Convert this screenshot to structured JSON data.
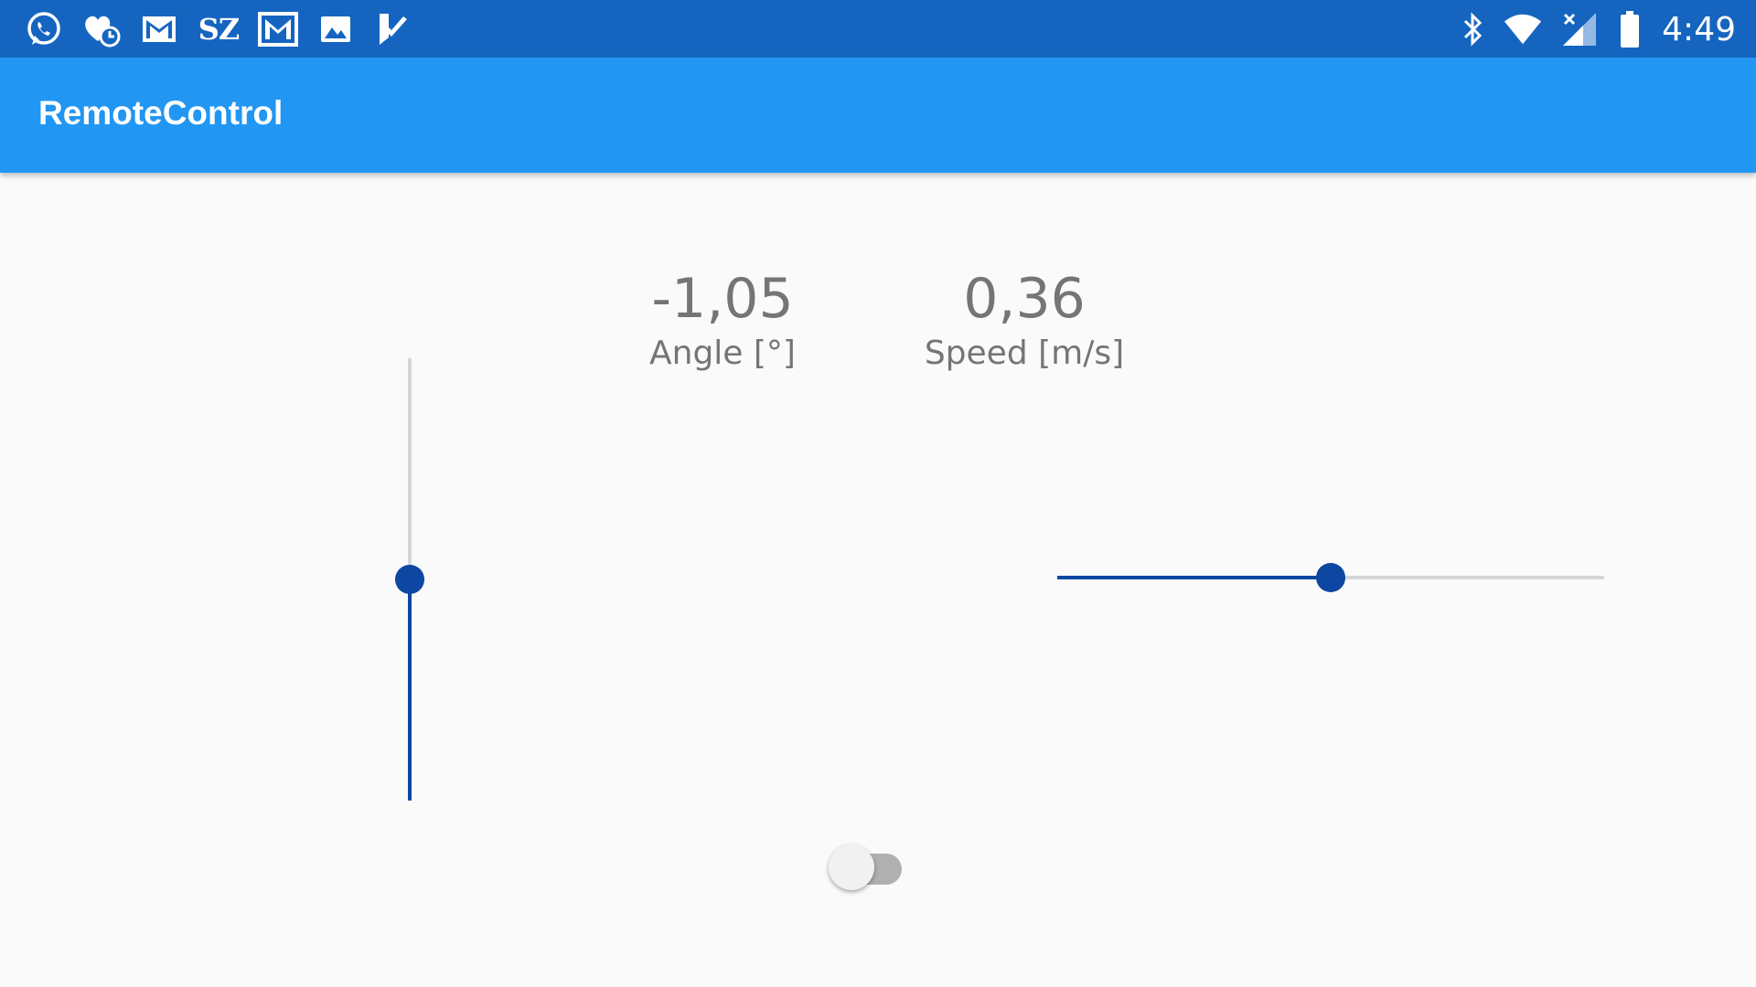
{
  "status_bar": {
    "left_icons": [
      "whatsapp-icon",
      "health-app-icon",
      "gmail-icon",
      "sz-news-icon",
      "gmail-inbox-icon",
      "gallery-icon",
      "todo-check-icon"
    ],
    "sz_text": "SZ",
    "right_icons": [
      "bluetooth-icon",
      "wifi-icon",
      "cell-signal-icon",
      "battery-icon"
    ],
    "time": "4:49",
    "color": "#1565c0"
  },
  "app_bar": {
    "title": "RemoteControl",
    "color": "#2196f3"
  },
  "readouts": {
    "angle": {
      "value": "-1,05",
      "label": "Angle [°]"
    },
    "speed": {
      "value": "0,36",
      "label": "Speed [m/s]"
    }
  },
  "controls": {
    "angle_slider": {
      "orientation": "vertical",
      "level": 0.5
    },
    "speed_slider": {
      "orientation": "horizontal",
      "level": 0.5
    },
    "enable_switch": {
      "on": false
    },
    "accent_color": "#0d47a1",
    "track_color": "#d6d6d6"
  }
}
